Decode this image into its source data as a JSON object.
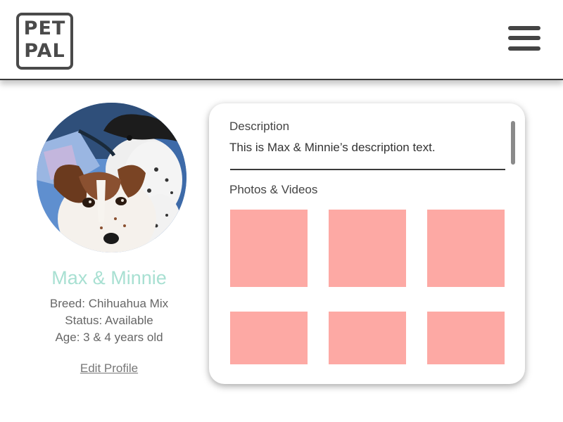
{
  "header": {
    "logo": {
      "line1": "PET",
      "line2": "PAL"
    },
    "menu_icon": "hamburger-menu-icon"
  },
  "profile": {
    "avatar_icon": "pet-photo",
    "name": "Max & Minnie",
    "breed": "Breed: Chihuahua Mix",
    "status": "Status: Available",
    "age": "Age: 3 & 4 years old",
    "edit_label": "Edit Profile",
    "name_color": "#a8e0d2"
  },
  "details": {
    "description_label": "Description",
    "description_text": "This is Max & Minnie’s description text.",
    "photos_label": "Photos & Videos",
    "photos": [
      {
        "color": "#fda9a4"
      },
      {
        "color": "#fda9a4"
      },
      {
        "color": "#fda9a4"
      },
      {
        "color": "#fda9a4"
      },
      {
        "color": "#fda9a4"
      },
      {
        "color": "#fda9a4"
      }
    ]
  }
}
